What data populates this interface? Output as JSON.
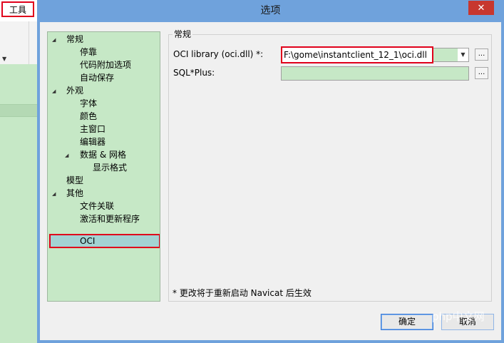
{
  "app": {
    "menu_tools": "工具"
  },
  "dialog": {
    "title": "选项",
    "close_glyph": "✕"
  },
  "tree": {
    "items": [
      {
        "label": "常规",
        "expander": "◢"
      },
      {
        "label": "停靠"
      },
      {
        "label": "代码附加选项"
      },
      {
        "label": "自动保存"
      },
      {
        "label": "外观",
        "expander": "◢"
      },
      {
        "label": "字体"
      },
      {
        "label": "颜色"
      },
      {
        "label": "主窗口"
      },
      {
        "label": "编辑器"
      },
      {
        "label": "数据 & 网格",
        "expander": "◢"
      },
      {
        "label": "显示格式"
      },
      {
        "label": "模型"
      },
      {
        "label": "其他",
        "expander": "◢"
      },
      {
        "label": "文件关联"
      },
      {
        "label": "激活和更新程序"
      },
      {
        "label": "OCI"
      }
    ],
    "selected": "OCI"
  },
  "content": {
    "group_label": "常规",
    "oci_label": "OCI library (oci.dll) *:",
    "oci_value": "F:\\gome\\instantclient_12_1\\oci.dll",
    "sqlplus_label": "SQL*Plus:",
    "sqlplus_value": "",
    "ellipsis": "...",
    "note": "* 更改将于重新启动 Navicat 后生效"
  },
  "buttons": {
    "ok": "确定",
    "cancel": "取消"
  },
  "watermark": {
    "brand": "php",
    "suffix": "中文网"
  },
  "icons": {
    "dropdown": "▼",
    "expander": "◢"
  }
}
